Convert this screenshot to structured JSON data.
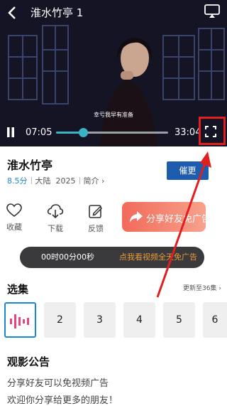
{
  "player": {
    "title": "淮水竹亭 1",
    "subtitle": "幸亏我早有准备",
    "current_time": "07:05",
    "duration": "33:04",
    "progress": 0.24
  },
  "show": {
    "title": "淮水竹亭",
    "score": "8.5分",
    "region": "大陆",
    "year": "2025",
    "intro_label": "简介 ›",
    "urge_button": "催更"
  },
  "actions": [
    {
      "label": "收藏",
      "icon": "heart-icon"
    },
    {
      "label": "下载",
      "icon": "cloud-download-icon"
    },
    {
      "label": "反馈",
      "icon": "feedback-edit-icon"
    }
  ],
  "share_button": "分享好友免广告",
  "ad_banner": {
    "timer": "00时00分00秒",
    "link": "点我看视频全天免广告"
  },
  "episodes_section": {
    "title": "选集",
    "more": "更新至36集 ›",
    "items": [
      "",
      "2",
      "3",
      "4",
      "5",
      "6"
    ]
  },
  "notice": {
    "title": "观影公告",
    "lines": [
      "分享好友可以免视频广告",
      "欢迎你分享给更多的朋友！"
    ]
  },
  "colors": {
    "accent_blue": "#1b86c9",
    "progress": "#3ab3c2",
    "highlight_red": "#e02020",
    "share_gradient_start": "#f26a5a",
    "ad_link": "#e89a3a"
  }
}
